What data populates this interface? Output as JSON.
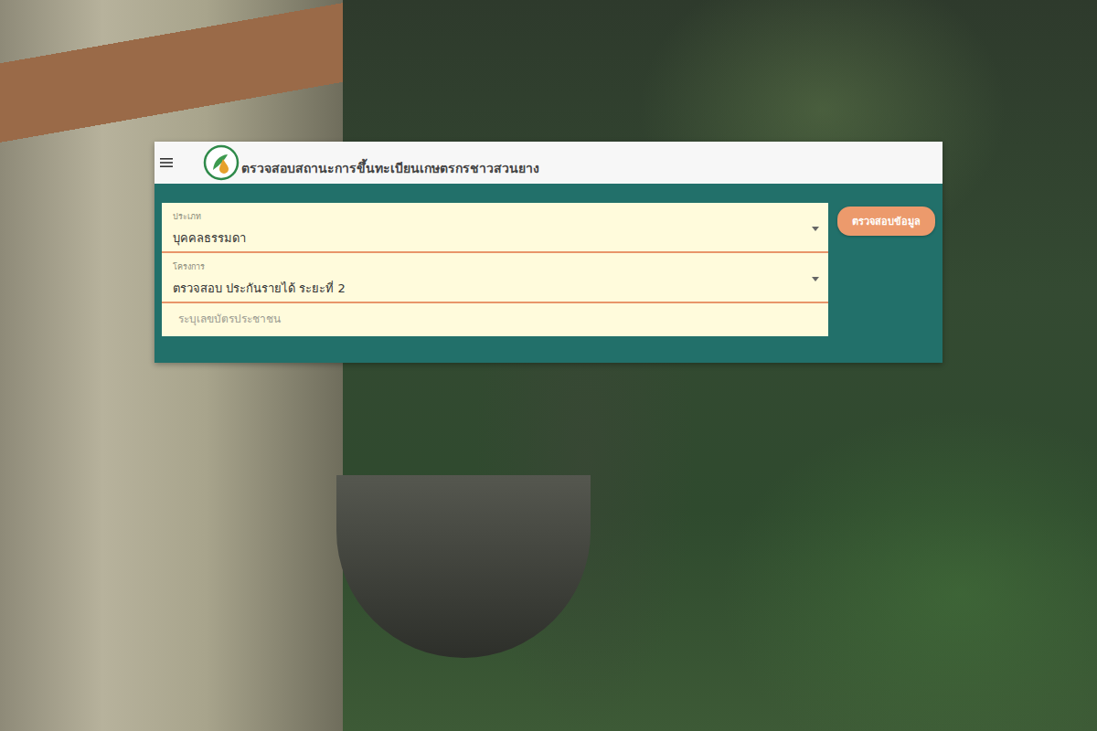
{
  "header": {
    "title": "ตรวจสอบสถานะการขึ้นทะเบียนเกษตรกรชาวสวนยาง"
  },
  "form": {
    "fields": [
      {
        "kind": "select",
        "label": "ประเภท",
        "value": "บุคคลธรรมดา"
      },
      {
        "kind": "select",
        "label": "โครงการ",
        "value": "ตรวจสอบ ประกันรายได้ ระยะที่ 2"
      },
      {
        "kind": "input",
        "placeholder": "ระบุเลขบัตรประชาชน"
      }
    ]
  },
  "buttons": [
    "ตรวจสอบข้อมูล"
  ]
}
